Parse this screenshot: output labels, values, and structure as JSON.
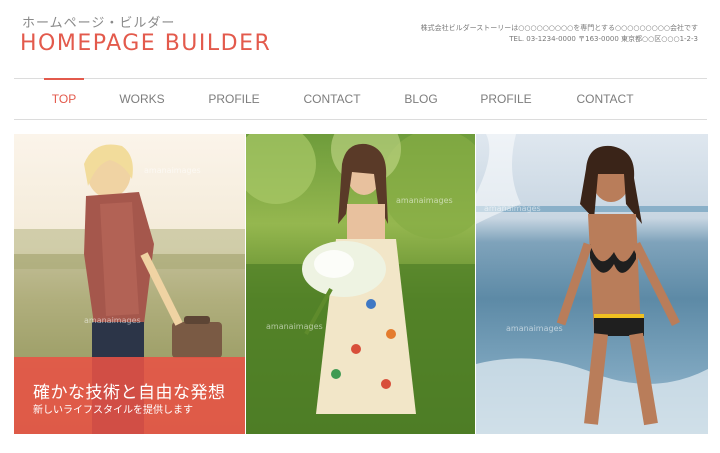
{
  "header": {
    "logo_sub": "ホームページ・ビルダー",
    "logo_main": "HOMEPAGE BUILDER",
    "company_line": "株式会社ビルダーストーリーは○○○○○○○○○を専門とする○○○○○○○○○会社です",
    "address_line": "TEL. 03-1234-0000 〒163-0000 東京都○○区○○○1-2-3"
  },
  "nav": {
    "items": [
      {
        "label": "TOP",
        "active": true
      },
      {
        "label": "WORKS",
        "active": false
      },
      {
        "label": "PROFILE",
        "active": false
      },
      {
        "label": "CONTACT",
        "active": false
      },
      {
        "label": "BLOG",
        "active": false
      },
      {
        "label": "PROFILE",
        "active": false
      },
      {
        "label": "CONTACT",
        "active": false
      }
    ]
  },
  "gallery": {
    "watermark": "amanaimages",
    "caption_title": "確かな技術と自由な発想",
    "caption_sub": "新しいライフスタイルを提供します"
  },
  "colors": {
    "accent": "#e35a4c",
    "caption_bg": "#e85244",
    "nav_text": "#7d7d7d"
  }
}
